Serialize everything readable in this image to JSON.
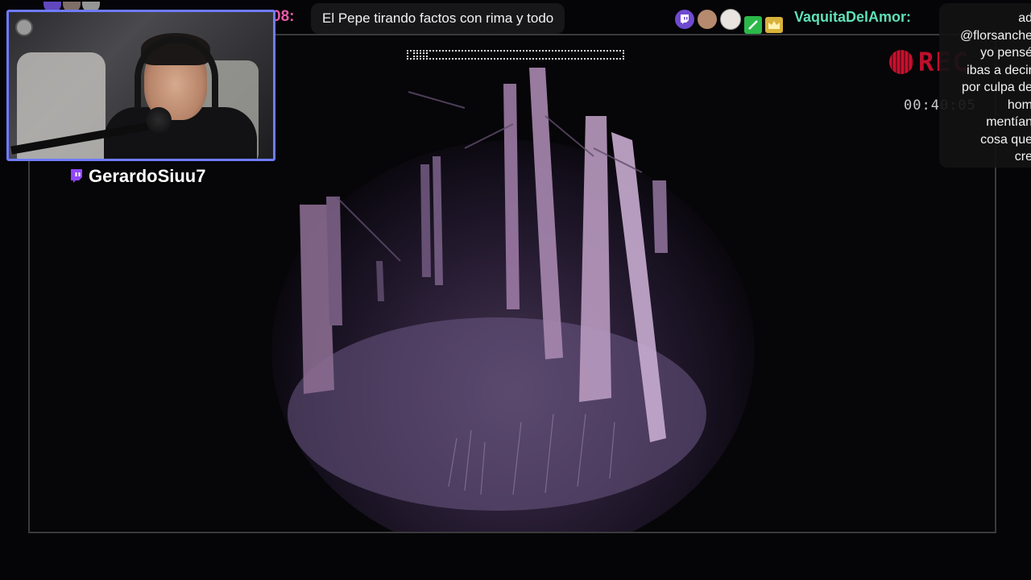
{
  "overlay": {
    "streamer_name": "GerardoSiuu7",
    "prev_timestamp_fragment": "08:",
    "chat_bubble_text": "El Pepe tirando factos con rima y todo",
    "current_chat_user": "VaquitaDelAmor:",
    "chat_message_lines": [
      "ad",
      "@florsanche",
      "yo pensé",
      "ibas a decir",
      "por culpa de",
      "hom",
      "mentían",
      "cosa que",
      "cre"
    ]
  },
  "game_hud": {
    "rec_label": "REC",
    "timer": "00:40:05"
  },
  "colors": {
    "webcam_border": "#6f7bff",
    "twitch_purple": "#9146ff",
    "chat_user": "#5fe0b6",
    "timestamp_pink": "#e85aa8",
    "rec_red": "#c8102e"
  },
  "icons": [
    "twitch-icon",
    "user-avatar-icon",
    "sword-badge-icon",
    "crown-badge-icon",
    "rec-dot-icon"
  ]
}
